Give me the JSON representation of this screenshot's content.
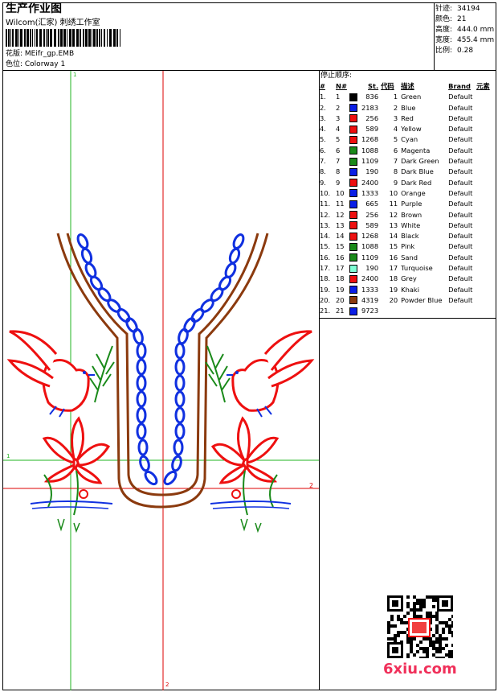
{
  "header": {
    "title": "生产作业图",
    "studio": "Wilcom(汇家) 刺绣工作室",
    "design": "花版: MEifr_gp.EMB",
    "colorway": "色位: Colorway 1"
  },
  "stats": [
    {
      "label": "针迹:",
      "value": "34194"
    },
    {
      "label": "颜色:",
      "value": "21"
    },
    {
      "label": "高度:",
      "value": "444.0 mm"
    },
    {
      "label": "宽度:",
      "value": "455.4 mm"
    },
    {
      "label": "比例:",
      "value": "0.28"
    }
  ],
  "stop_sequence": {
    "title": "停止顺序:",
    "headers": [
      "#",
      "N#",
      "St.",
      "代码",
      "描述",
      "Brand",
      "元素"
    ],
    "rows": [
      {
        "n": "1.",
        "needle": "1",
        "color": "#000000",
        "st": "836",
        "code": "1",
        "desc": "Green",
        "brand": "Default"
      },
      {
        "n": "2.",
        "needle": "2",
        "color": "#0a1ee6",
        "st": "2183",
        "code": "2",
        "desc": "Blue",
        "brand": "Default"
      },
      {
        "n": "3.",
        "needle": "3",
        "color": "#ee1010",
        "st": "256",
        "code": "3",
        "desc": "Red",
        "brand": "Default"
      },
      {
        "n": "4.",
        "needle": "4",
        "color": "#ee1010",
        "st": "589",
        "code": "4",
        "desc": "Yellow",
        "brand": "Default"
      },
      {
        "n": "5.",
        "needle": "5",
        "color": "#ee1010",
        "st": "1268",
        "code": "5",
        "desc": "Cyan",
        "brand": "Default"
      },
      {
        "n": "6.",
        "needle": "6",
        "color": "#1a8a1a",
        "st": "1088",
        "code": "6",
        "desc": "Magenta",
        "brand": "Default"
      },
      {
        "n": "7.",
        "needle": "7",
        "color": "#1a8a1a",
        "st": "1109",
        "code": "7",
        "desc": "Dark Green",
        "brand": "Default"
      },
      {
        "n": "8.",
        "needle": "8",
        "color": "#0a1ee6",
        "st": "190",
        "code": "8",
        "desc": "Dark Blue",
        "brand": "Default"
      },
      {
        "n": "9.",
        "needle": "9",
        "color": "#ee1010",
        "st": "2400",
        "code": "9",
        "desc": "Dark Red",
        "brand": "Default"
      },
      {
        "n": "10.",
        "needle": "10",
        "color": "#0a1ee6",
        "st": "1333",
        "code": "10",
        "desc": "Orange",
        "brand": "Default"
      },
      {
        "n": "11.",
        "needle": "11",
        "color": "#0a1ee6",
        "st": "665",
        "code": "11",
        "desc": "Purple",
        "brand": "Default"
      },
      {
        "n": "12.",
        "needle": "12",
        "color": "#ee1010",
        "st": "256",
        "code": "12",
        "desc": "Brown",
        "brand": "Default"
      },
      {
        "n": "13.",
        "needle": "13",
        "color": "#ee1010",
        "st": "589",
        "code": "13",
        "desc": "White",
        "brand": "Default"
      },
      {
        "n": "14.",
        "needle": "14",
        "color": "#ee1010",
        "st": "1268",
        "code": "14",
        "desc": "Black",
        "brand": "Default"
      },
      {
        "n": "15.",
        "needle": "15",
        "color": "#1a8a1a",
        "st": "1088",
        "code": "15",
        "desc": "Pink",
        "brand": "Default"
      },
      {
        "n": "16.",
        "needle": "16",
        "color": "#1a8a1a",
        "st": "1109",
        "code": "16",
        "desc": "Sand",
        "brand": "Default"
      },
      {
        "n": "17.",
        "needle": "17",
        "color": "#7fffd4",
        "st": "190",
        "code": "17",
        "desc": "Turquoise",
        "brand": "Default"
      },
      {
        "n": "18.",
        "needle": "18",
        "color": "#ee1010",
        "st": "2400",
        "code": "18",
        "desc": "Grey",
        "brand": "Default"
      },
      {
        "n": "19.",
        "needle": "19",
        "color": "#0a1ee6",
        "st": "1333",
        "code": "19",
        "desc": "Khaki",
        "brand": "Default"
      },
      {
        "n": "20.",
        "needle": "20",
        "color": "#8b3a0e",
        "st": "4319",
        "code": "20",
        "desc": "Powder Blue",
        "brand": "Default"
      },
      {
        "n": "21.",
        "needle": "21",
        "color": "#0a1ee6",
        "st": "9723",
        "code": "",
        "desc": "",
        "brand": ""
      }
    ]
  },
  "guides": {
    "v1": "1",
    "v2": "2",
    "h1": "1",
    "h2": "2"
  },
  "watermark": "6xiu.com",
  "colors": {
    "guide_green": "#22b422",
    "guide_red": "#dd0000",
    "brown": "#8b3a0e",
    "blue": "#1030e0",
    "red": "#ee1010",
    "green": "#1a8a1a"
  }
}
